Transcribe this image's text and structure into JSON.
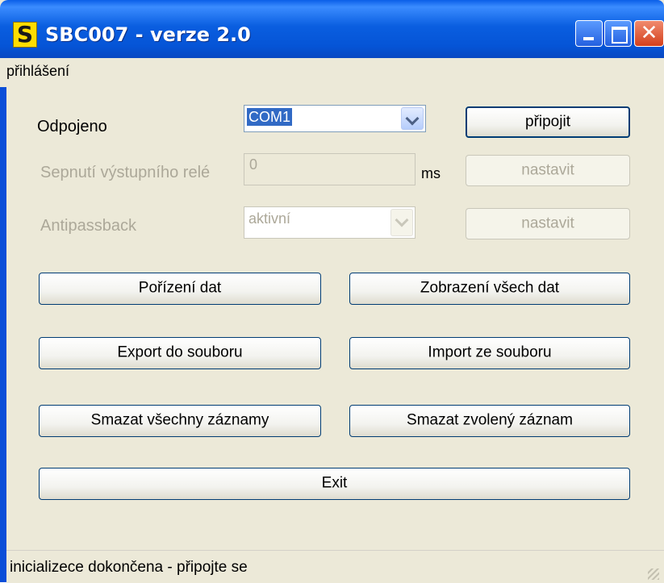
{
  "window": {
    "title": "SBC007 - verze 2.0",
    "icon_letter": "S"
  },
  "menu": {
    "items": [
      "přihlášení"
    ]
  },
  "connection": {
    "status_label": "Odpojeno",
    "port_value": "COM1",
    "connect_button": "připojit"
  },
  "relay": {
    "label": "Sepnutí výstupního relé",
    "value": "0",
    "unit": "ms",
    "set_button": "nastavit"
  },
  "antipassback": {
    "label": "Antipassback",
    "value": "aktivní",
    "set_button": "nastavit"
  },
  "actions": {
    "acquire": "Pořízení dat",
    "show_all": "Zobrazení všech dat",
    "export": "Export do souboru",
    "import": "Import ze souboru",
    "delete_all": "Smazat všechny záznamy",
    "delete_selected": "Smazat zvolený záznam",
    "exit": "Exit"
  },
  "status": {
    "text": "inicializece dokončena - připojte se"
  },
  "colors": {
    "titlebar": "#0a5ee0",
    "face": "#ece9d8",
    "close": "#d4401c",
    "selection": "#316ac5"
  }
}
